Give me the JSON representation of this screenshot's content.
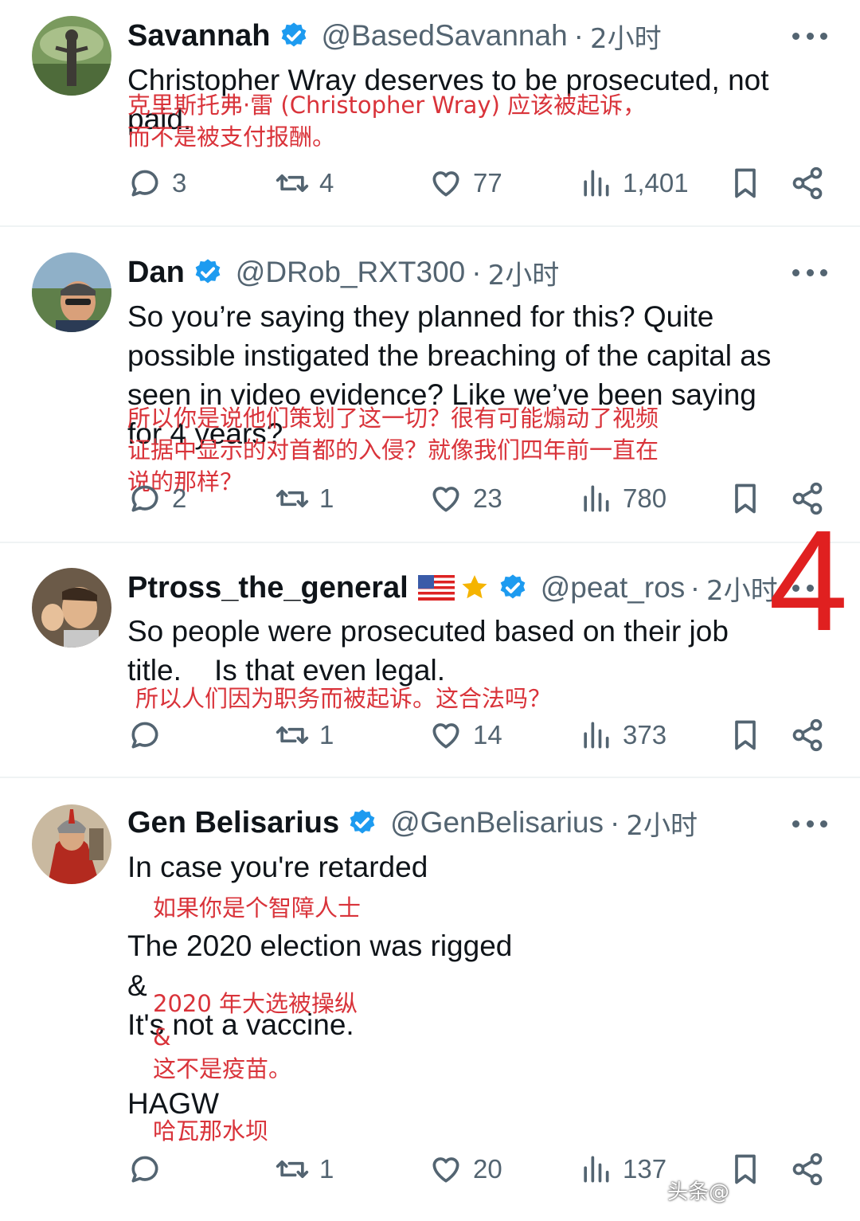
{
  "tweets": [
    {
      "name": "Savannah",
      "handle": "@BasedSavannah",
      "time": "2小时",
      "lines": [
        "Christopher Wray deserves to be prosecuted, not",
        "paid."
      ],
      "translation": [
        "克里斯托弗·雷 (Christopher Wray) 应该被起诉，",
        "而不是被支付报酬。"
      ],
      "replies": "3",
      "reposts": "4",
      "likes": "77",
      "views": "1,401"
    },
    {
      "name": "Dan",
      "handle": "@DRob_RXT300",
      "time": "2小时",
      "lines": [
        "So you’re saying they planned for this? Quite",
        "possible instigated the breaching of the capital as",
        "seen in video evidence? Like we’ve been saying",
        "for 4 years?"
      ],
      "translation": [
        "所以你是说他们策划了这一切？很有可能煽动了视频",
        "证据中显示的对首都的入侵？就像我们四年前一直在",
        "说的那样？"
      ],
      "replies": "2",
      "reposts": "1",
      "likes": "23",
      "views": "780"
    },
    {
      "name": "Ptross_the_general",
      "handle": "@peat_ros",
      "time": "2小时",
      "lines": [
        "So people were prosecuted based on their job",
        "title.    Is that even legal."
      ],
      "translation": [
        "所以人们因为职务而被起诉。这合法吗？"
      ],
      "replies": "",
      "reposts": "1",
      "likes": "14",
      "views": "373"
    },
    {
      "name": "Gen Belisarius",
      "handle": "@GenBelisarius",
      "time": "2小时",
      "lines": [
        "In case you're retarded",
        "The 2020 election was rigged",
        "&",
        "It's not a vaccine.",
        "HAGW"
      ],
      "translation": [
        "如果你是个智障人士",
        "2020 年大选被操纵",
        "&",
        "这不是疫苗。",
        "哈瓦那水坝"
      ],
      "replies": "",
      "reposts": "1",
      "likes": "20",
      "views": "137"
    }
  ],
  "overlay_number": "4",
  "watermark": "头条@"
}
